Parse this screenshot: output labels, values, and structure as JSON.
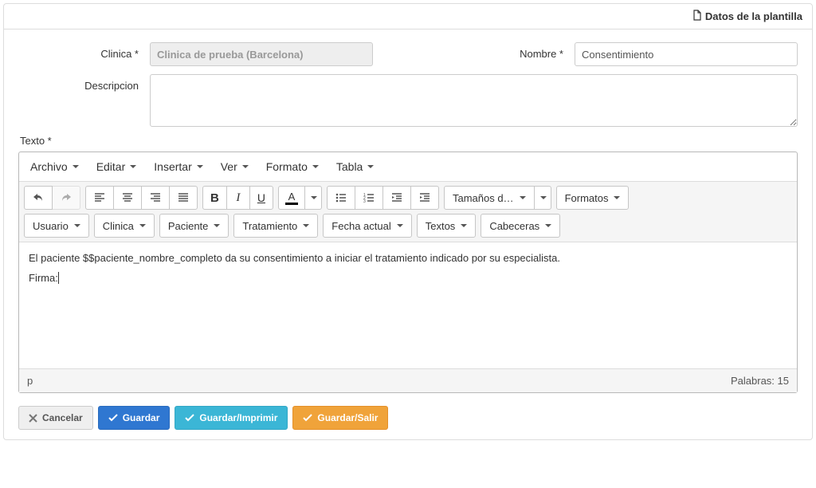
{
  "header": {
    "title": "Datos de la plantilla"
  },
  "form": {
    "clinica_label": "Clinica *",
    "clinica_value": "Clinica de prueba (Barcelona)",
    "nombre_label": "Nombre *",
    "nombre_value": "Consentimiento",
    "descripcion_label": "Descripcion",
    "descripcion_value": ""
  },
  "editor": {
    "label": "Texto *",
    "menubar": {
      "archivo": "Archivo",
      "editar": "Editar",
      "insertar": "Insertar",
      "ver": "Ver",
      "formato": "Formato",
      "tabla": "Tabla"
    },
    "toolbar": {
      "sizes_label": "Tamaños d…",
      "formats_label": "Formatos",
      "insert_menus": {
        "usuario": "Usuario",
        "clinica": "Clinica",
        "paciente": "Paciente",
        "tratamiento": "Tratamiento",
        "fecha_actual": "Fecha actual",
        "textos": "Textos",
        "cabeceras": "Cabeceras"
      }
    },
    "content": {
      "line1": "El paciente $$paciente_nombre_completo da su consentimiento a iniciar el tratamiento indicado por su especialista.",
      "line2": "Firma:"
    },
    "statusbar": {
      "path": "p",
      "words_label": "Palabras: 15"
    }
  },
  "actions": {
    "cancel": "Cancelar",
    "save": "Guardar",
    "save_print": "Guardar/Imprimir",
    "save_exit": "Guardar/Salir"
  }
}
